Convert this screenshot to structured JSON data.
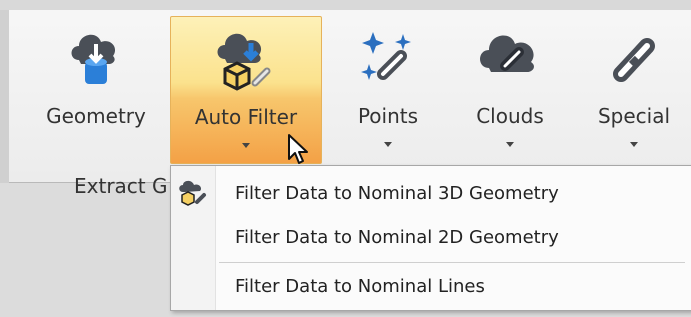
{
  "ribbon": {
    "buttons": [
      {
        "label": "Geometry",
        "icon": "cloud-download-cylinder-icon",
        "has_dropdown": false,
        "active": false
      },
      {
        "label": "Auto Filter",
        "icon": "cloud-download-cube-link-icon",
        "has_dropdown": true,
        "active": true
      },
      {
        "label": "Points",
        "icon": "sparkle-link-icon",
        "has_dropdown": true,
        "active": false
      },
      {
        "label": "Clouds",
        "icon": "cloud-link-icon",
        "has_dropdown": true,
        "active": false
      },
      {
        "label": "Special",
        "icon": "link-icon",
        "has_dropdown": true,
        "active": false
      }
    ],
    "group_label": "Extract G"
  },
  "menu": {
    "items": [
      {
        "label": "Filter Data to Nominal 3D Geometry",
        "icon": "cloud-cube-link-icon"
      },
      {
        "label": "Filter Data to Nominal 2D Geometry"
      },
      {
        "label": "Filter Data to Nominal Lines"
      }
    ]
  },
  "colors": {
    "active_top": "#fdf1b8",
    "active_bottom": "#f4a146",
    "icon_dark": "#4a4f57",
    "icon_blue": "#2b7fd8",
    "icon_gold": "#e0a423"
  }
}
